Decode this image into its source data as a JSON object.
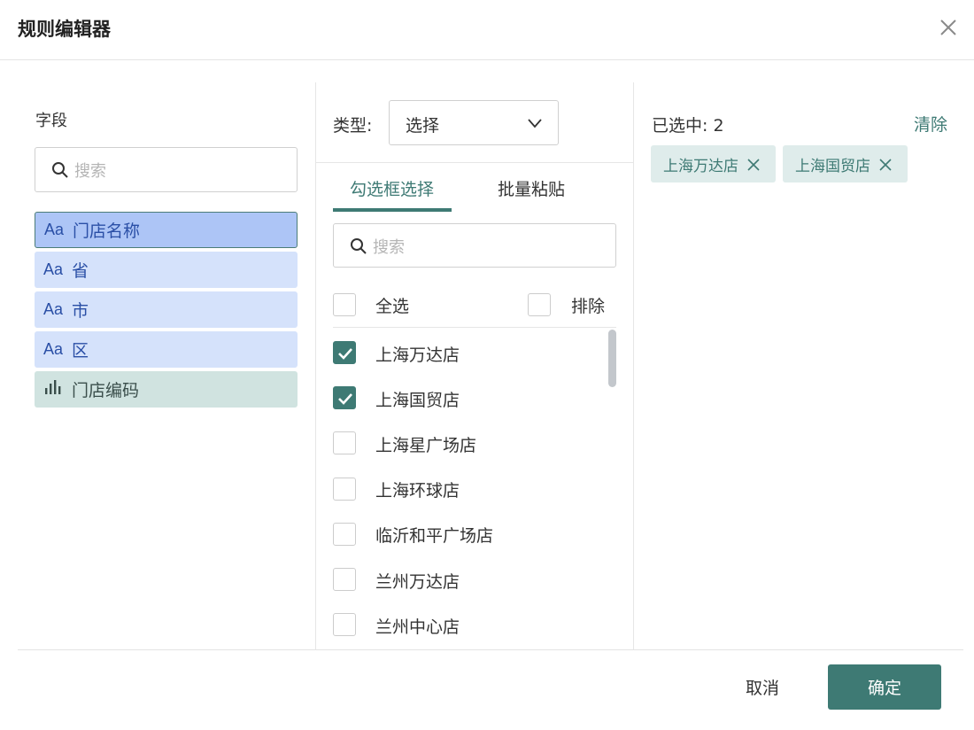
{
  "dialog": {
    "title": "规则编辑器",
    "close_icon": "close-icon"
  },
  "fields_panel": {
    "label": "字段",
    "search_placeholder": "搜索",
    "items": [
      {
        "icon": "Aa",
        "icon_name": "text-type-icon",
        "label": "门店名称",
        "selected": true
      },
      {
        "icon": "Aa",
        "icon_name": "text-type-icon",
        "label": "省",
        "selected": false
      },
      {
        "icon": "Aa",
        "icon_name": "text-type-icon",
        "label": "市",
        "selected": false
      },
      {
        "icon": "Aa",
        "icon_name": "text-type-icon",
        "label": "区",
        "selected": false
      },
      {
        "icon": "",
        "icon_name": "bar-chart-icon",
        "label": "门店编码",
        "selected": false
      }
    ]
  },
  "filter_panel": {
    "type_label": "类型:",
    "type_value": "选择",
    "tabs": [
      {
        "label": "勾选框选择",
        "active": true
      },
      {
        "label": "批量粘贴",
        "active": false
      }
    ],
    "search_placeholder": "搜索",
    "select_all_label": "全选",
    "exclude_label": "排除",
    "options": [
      {
        "label": "上海万达店",
        "checked": true
      },
      {
        "label": "上海国贸店",
        "checked": true
      },
      {
        "label": "上海星广场店",
        "checked": false
      },
      {
        "label": "上海环球店",
        "checked": false
      },
      {
        "label": "临沂和平广场店",
        "checked": false
      },
      {
        "label": "兰州万达店",
        "checked": false
      },
      {
        "label": "兰州中心店",
        "checked": false
      }
    ]
  },
  "selected_panel": {
    "count_label": "已选中: 2",
    "clear_label": "清除",
    "tags": [
      "上海万达店",
      "上海国贸店"
    ]
  },
  "footer": {
    "cancel_label": "取消",
    "ok_label": "确定"
  },
  "colors": {
    "accent": "#3e7a74",
    "field_bg": "#d5e2fb",
    "field_selected_bg": "#adc5f6",
    "tag_bg": "#dfeceb"
  }
}
